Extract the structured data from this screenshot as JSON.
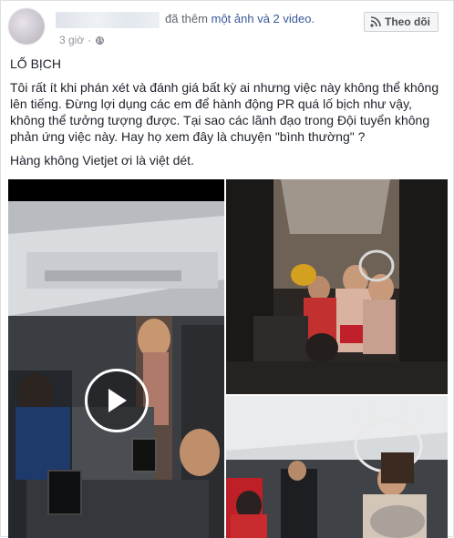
{
  "header": {
    "action_text": "đã thêm",
    "action_link": "một ảnh và 2 video.",
    "time": "3 giờ",
    "privacy_icon": "globe-icon",
    "follow_icon": "rss-icon",
    "follow_label": "Theo dõi"
  },
  "post": {
    "title": "LỐ BỊCH",
    "body": "Tôi rất ít khi phán xét và đánh giá bất kỳ ai nhưng việc này không thể không lên tiếng. Đừng lợi dụng các em để hành động PR quá lố bịch như vậy, không thể tưởng tượng được. Tại sao các lãnh đạo trong Đội tuyển không phản ứng việc này. Hay họ xem đây là chuyện \"bình thường\" ?",
    "footer": "Hàng không Vietjet ơi là việt dét."
  },
  "media": {
    "main_video_icon": "play-icon"
  },
  "colors": {
    "link": "#385898",
    "muted": "#90949c",
    "text": "#1d2129"
  }
}
